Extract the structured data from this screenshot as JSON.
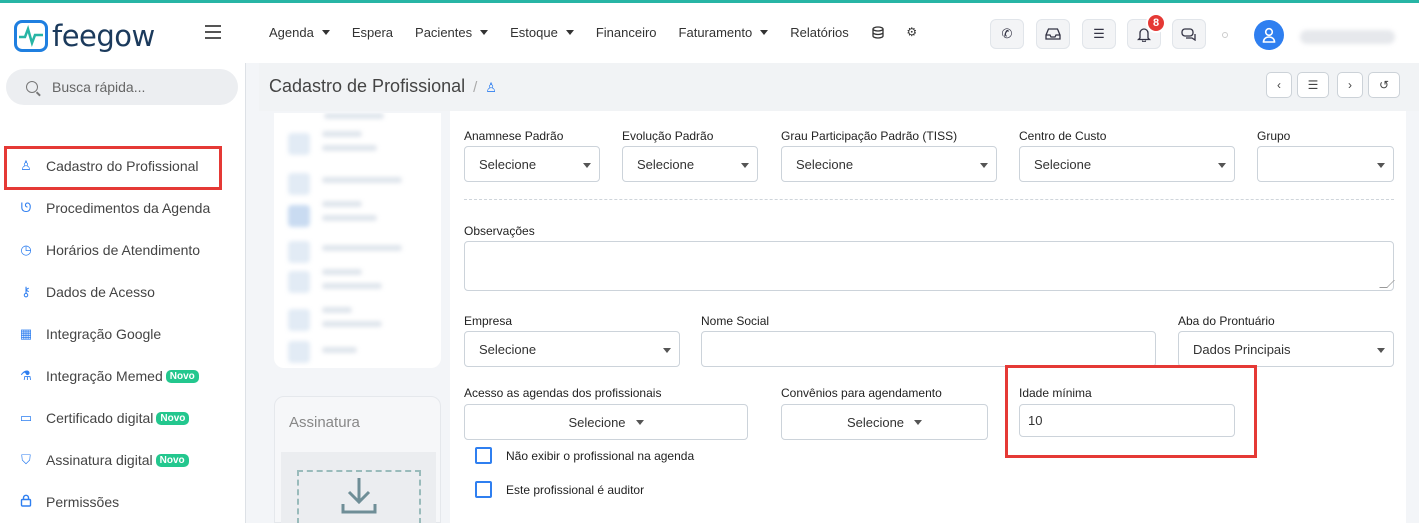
{
  "brand": {
    "logo_text": "feegow"
  },
  "topnav": {
    "items": [
      {
        "label": "Agenda",
        "caret": true
      },
      {
        "label": "Espera",
        "caret": false
      },
      {
        "label": "Pacientes",
        "caret": true
      },
      {
        "label": "Estoque",
        "caret": true
      },
      {
        "label": "Financeiro",
        "caret": false
      },
      {
        "label": "Faturamento",
        "caret": true
      },
      {
        "label": "Relatórios",
        "caret": false
      }
    ],
    "icons": [
      "database-icon",
      "gear-icon"
    ],
    "toolbar_icons": [
      "phone-icon",
      "inbox-icon",
      "checklist-icon",
      "bell-icon",
      "chat-icon"
    ],
    "notification_count": "8"
  },
  "sidebar": {
    "search_placeholder": "Busca rápida...",
    "items": [
      {
        "label": "Cadastro do Profissional",
        "icon": "user-icon",
        "glyph": "♙"
      },
      {
        "label": "Procedimentos da Agenda",
        "icon": "stethoscope-icon",
        "glyph": "ᘎ"
      },
      {
        "label": "Horários de Atendimento",
        "icon": "clock-icon",
        "glyph": "◷"
      },
      {
        "label": "Dados de Acesso",
        "icon": "key-icon",
        "glyph": "⚷"
      },
      {
        "label": "Integração Google",
        "icon": "calendar-icon",
        "glyph": "▦"
      },
      {
        "label": "Integração Memed",
        "icon": "flask-icon",
        "glyph": "⚗",
        "badge": "Novo"
      },
      {
        "label": "Certificado digital",
        "icon": "card-icon",
        "glyph": "▭",
        "badge": "Novo"
      },
      {
        "label": "Assinatura digital",
        "icon": "shield-icon",
        "glyph": "⛉",
        "badge": "Novo"
      },
      {
        "label": "Permissões",
        "icon": "lock-icon",
        "glyph": "🔒︎"
      }
    ]
  },
  "page": {
    "title": "Cadastro de Profissional",
    "breadcrumb_sep": "/"
  },
  "signature": {
    "title": "Assinatura"
  },
  "form": {
    "anamnese": {
      "label": "Anamnese Padrão",
      "value": "Selecione"
    },
    "evolucao": {
      "label": "Evolução Padrão",
      "value": "Selecione"
    },
    "grau": {
      "label": "Grau Participação Padrão (TISS)",
      "value": "Selecione"
    },
    "centro": {
      "label": "Centro de Custo",
      "value": "Selecione"
    },
    "grupo": {
      "label": "Grupo",
      "value": ""
    },
    "observacoes": {
      "label": "Observações",
      "value": ""
    },
    "empresa": {
      "label": "Empresa",
      "value": "Selecione"
    },
    "nome_social": {
      "label": "Nome Social",
      "value": ""
    },
    "aba": {
      "label": "Aba do Prontuário",
      "value": "Dados Principais"
    },
    "acesso": {
      "label": "Acesso as agendas dos profissionais",
      "value": "Selecione"
    },
    "convenios": {
      "label": "Convênios para agendamento",
      "value": "Selecione"
    },
    "idade": {
      "label": "Idade mínima",
      "value": "10"
    },
    "checkbox_agenda": "Não exibir o profissional na agenda",
    "checkbox_auditor": "Este profissional é auditor"
  }
}
